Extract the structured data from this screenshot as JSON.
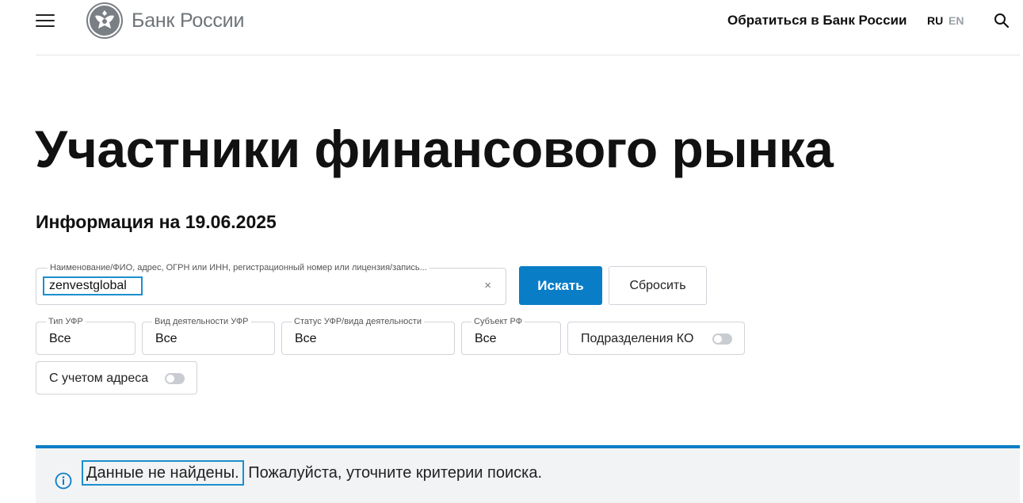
{
  "header": {
    "menu_icon": "hamburger-icon",
    "logo_icon": "double-headed-eagle-emblem",
    "logo_text": "Банк России",
    "contact_link": "Обратиться в Банк России",
    "lang_ru": "RU",
    "lang_en": "EN",
    "search_icon": "search-icon"
  },
  "page": {
    "title": "Участники финансового рынка",
    "info_date": "Информация на 19.06.2025"
  },
  "search": {
    "legend": "Наименование/ФИО, адрес, ОГРН или ИНН, регистрационный номер или лицензия/запись...",
    "value": "zenvestglobal",
    "clear_symbol": "×",
    "submit_label": "Искать",
    "reset_label": "Сбросить"
  },
  "filters": [
    {
      "legend": "Тип УФР",
      "value": "Все"
    },
    {
      "legend": "Вид деятельности УФР",
      "value": "Все"
    },
    {
      "legend": "Статус УФР/вида деятельности",
      "value": "Все"
    },
    {
      "legend": "Субъект РФ",
      "value": "Все"
    }
  ],
  "toggles": {
    "ko_branches": {
      "label": "Подразделения КО",
      "on": false
    },
    "with_address": {
      "label": "С учетом адреса",
      "on": false
    }
  },
  "notice": {
    "icon": "info-icon",
    "highlight": "Данные не найдены.",
    "rest": " Пожалуйста, уточните критерии поиска.",
    "accent_color": "#0a7dc7"
  }
}
